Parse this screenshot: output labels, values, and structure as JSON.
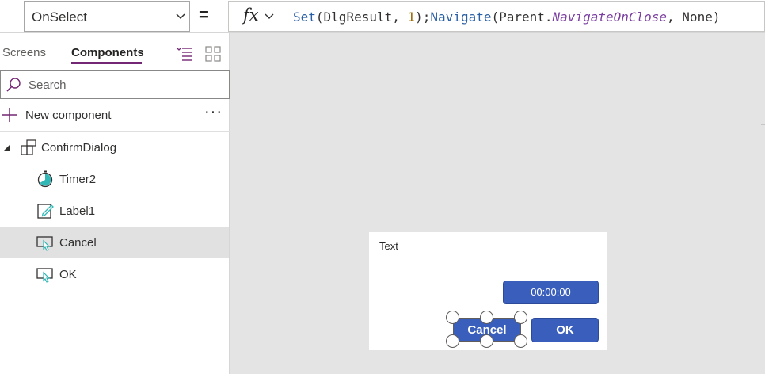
{
  "formula_bar": {
    "property": "OnSelect",
    "equals": "=",
    "fx": "fx",
    "formula": {
      "t1": "Set",
      "t2": "(DlgResult, ",
      "t3": "1",
      "t4": ");",
      "t5": "Navigate",
      "t6": "(Parent.",
      "t7": "NavigateOnClose",
      "t8": ", None)"
    }
  },
  "left_pane": {
    "tabs": {
      "screens": "Screens",
      "components": "Components"
    },
    "search_placeholder": "Search",
    "new_component": "New component",
    "more": "···",
    "tree": {
      "root": "ConfirmDialog",
      "children": [
        "Timer2",
        "Label1",
        "Cancel",
        "OK"
      ],
      "selected": "Cancel"
    }
  },
  "canvas": {
    "label_text": "Text",
    "timer_text": "00:00:00",
    "cancel_label": "Cancel",
    "ok_label": "OK"
  },
  "colors": {
    "accent": "#742774",
    "button": "#3a5ebb",
    "selected_row": "#e1e1e1",
    "canvas_bg": "#e4e4e4"
  },
  "icons": {
    "property_dropdown": "chevron-down-icon",
    "list_view": "list-view-icon",
    "grid_view": "grid-view-icon",
    "search": "search-icon",
    "new": "plus-icon",
    "component": "component-icon",
    "timer": "timer-icon",
    "label": "label-edit-icon",
    "button": "button-icon"
  }
}
